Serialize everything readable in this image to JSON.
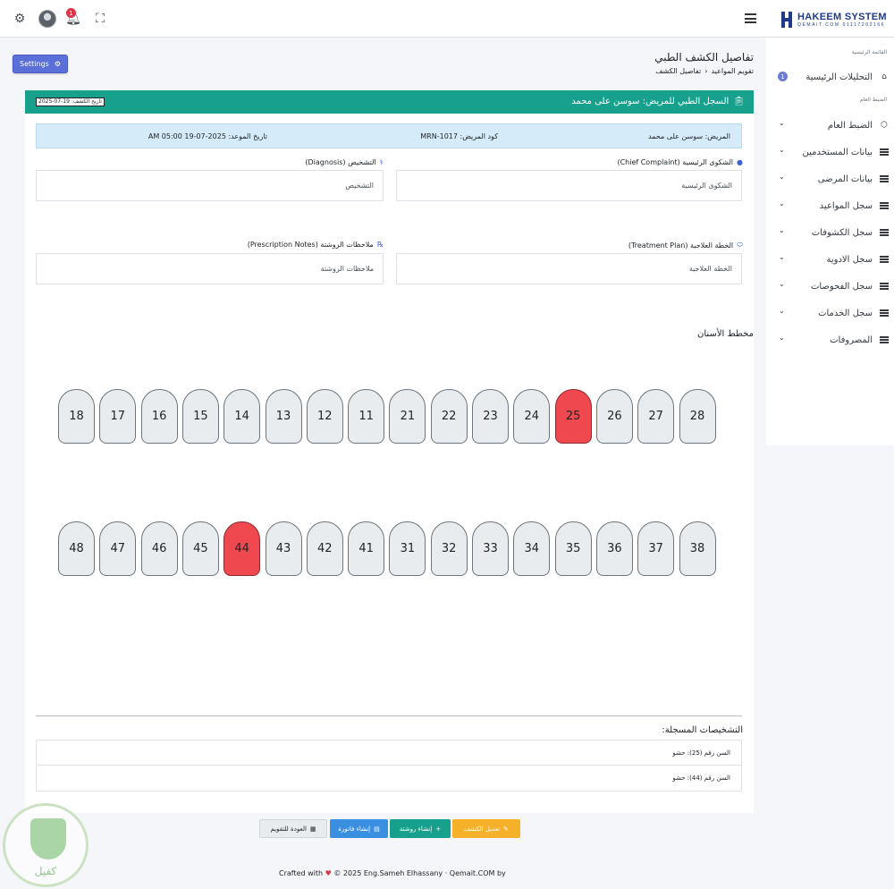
{
  "topbar": {
    "notification_count": "1",
    "brand_name": "HAKEEM SYSTEM",
    "brand_sub": "QEMAIT.COM 01117202166"
  },
  "sidebar": {
    "section_main": "القائمة الرئيسية",
    "section_general": "الضبط العام",
    "items": [
      {
        "label": "التحليلات الرئيسية",
        "badge": "1",
        "icon": "home-icon"
      },
      {
        "label": "الضبط العام",
        "icon": "box-icon"
      },
      {
        "label": "بيانات المستخدمين",
        "icon": "list-icon"
      },
      {
        "label": "بيانات المرضى",
        "icon": "list-icon"
      },
      {
        "label": "سجل المواعيد",
        "icon": "list-icon"
      },
      {
        "label": "سجل الكشوفات",
        "icon": "list-icon"
      },
      {
        "label": "سجل الادوية",
        "icon": "list-icon"
      },
      {
        "label": "سجل الفحوصات",
        "icon": "list-icon"
      },
      {
        "label": "سجل الخدمات",
        "icon": "list-icon"
      },
      {
        "label": "المصروفات",
        "icon": "list-icon"
      }
    ]
  },
  "header": {
    "settings_label": "Settings",
    "page_title": "تفاصيل الكشف الطبي",
    "breadcrumb": [
      "تقويم المواعيد",
      "تفاصيل الكشف"
    ]
  },
  "record": {
    "title": "السجل الطبي للمريض: سوسن على محمد",
    "visit_date": "تاريخ الكشف: 19-07-2025",
    "patient": "المريض: سوسن على محمد",
    "patient_code": "كود المريض: MRN-1017",
    "appointment_date": "تاريخ الموعد: 2025-07-19 05:00 AM"
  },
  "fields": {
    "complaint_label": "الشكوى الرئيسية (Chief Complaint)",
    "complaint_value": "الشكوى الرئيسية",
    "diagnosis_label": "التشخيص (Diagnosis)",
    "diagnosis_value": "التشخيص",
    "plan_label": "الخطة العلاجية (Treatment Plan)",
    "plan_value": "الخطة العلاجية",
    "rx_label": "ملاحظات الروشتة (Prescription Notes)",
    "rx_value": "ملاحظات الروشتة"
  },
  "dental_chart": {
    "title": "مخطط الأسنان",
    "upper": [
      "18",
      "17",
      "16",
      "15",
      "14",
      "13",
      "12",
      "11",
      "21",
      "22",
      "23",
      "24",
      "25",
      "26",
      "27",
      "28"
    ],
    "lower": [
      "48",
      "47",
      "46",
      "45",
      "44",
      "43",
      "42",
      "41",
      "31",
      "32",
      "33",
      "34",
      "35",
      "36",
      "37",
      "38"
    ],
    "marked": [
      "25",
      "44"
    ],
    "marked_color": "#f0484f"
  },
  "diagnoses": {
    "title": "التشخيصات المسجلة:",
    "rows": [
      "السن رقم (25): حشو",
      "السن رقم (44): حشو"
    ]
  },
  "actions": {
    "edit": "تعديل الكشف",
    "prescription": "إنشاء روشتة",
    "invoice": "إنشاء فاتورة",
    "back": "العودة للتقويم"
  },
  "footer": {
    "before": "© 2025 Eng.Sameh Elhassany · Qemait.COM by",
    "after": "Crafted with"
  },
  "watermark": {
    "text": "كفيل"
  },
  "colors": {
    "accent": "#17a08c",
    "primary": "#5b6fd9",
    "warning": "#f6b12a",
    "info": "#3b8fe0"
  }
}
